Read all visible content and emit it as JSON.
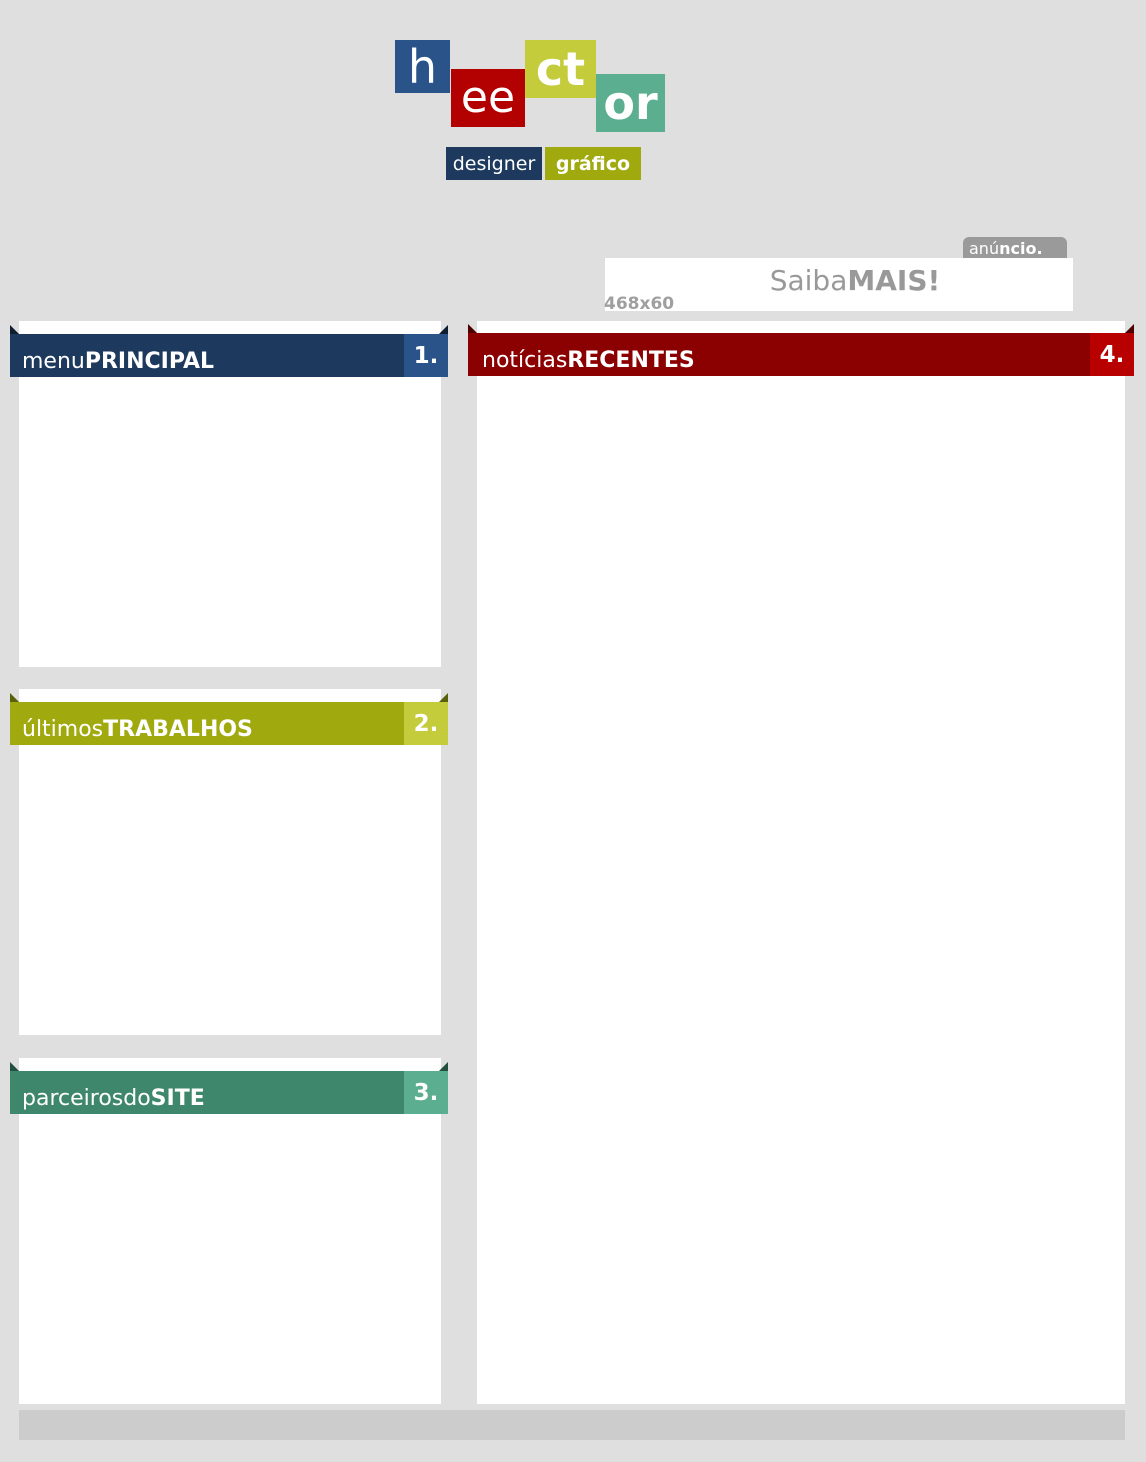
{
  "colors": {
    "navy": "#1d3a5e",
    "navy_light": "#2a5489",
    "crimson": "#8b0000",
    "crimson_light": "#b80000",
    "olive": "#a0aa0e",
    "olive_light": "#c4cc3c",
    "teal": "#3e876d",
    "teal_light": "#5cae90",
    "page_bg": "#dfdfdf",
    "ad_tab": "#9a9a9a"
  },
  "logo": {
    "tiles": [
      {
        "text": "h",
        "color": "#2a5489"
      },
      {
        "text": "ee",
        "color": "#b30000"
      },
      {
        "text": "ct",
        "color": "#c4cc3c"
      },
      {
        "text": "or",
        "color": "#5cae90"
      }
    ],
    "tagline": {
      "designer": "designer",
      "designer_color": "#1d3a5e",
      "grafico": "gráfico",
      "grafico_color": "#a0aa0e"
    }
  },
  "ad": {
    "tab_light": "anú",
    "tab_bold": "ncio.",
    "cta_light": "Saiba",
    "cta_bold": "MAIS!",
    "size": "468x60"
  },
  "panels": {
    "menu": {
      "title_light": "menu",
      "title_bold": "PRINCIPAL",
      "number": "1.",
      "icon": "number-badge"
    },
    "works": {
      "title_light": "últimos",
      "title_bold": "TRABALHOS",
      "number": "2.",
      "icon": "number-badge"
    },
    "partners": {
      "title_light": "parceirosdo",
      "title_bold": "SITE",
      "number": "3.",
      "icon": "number-badge"
    },
    "news": {
      "title_light": "notícias",
      "title_bold": "RECENTES",
      "number": "4.",
      "icon": "number-badge"
    }
  }
}
